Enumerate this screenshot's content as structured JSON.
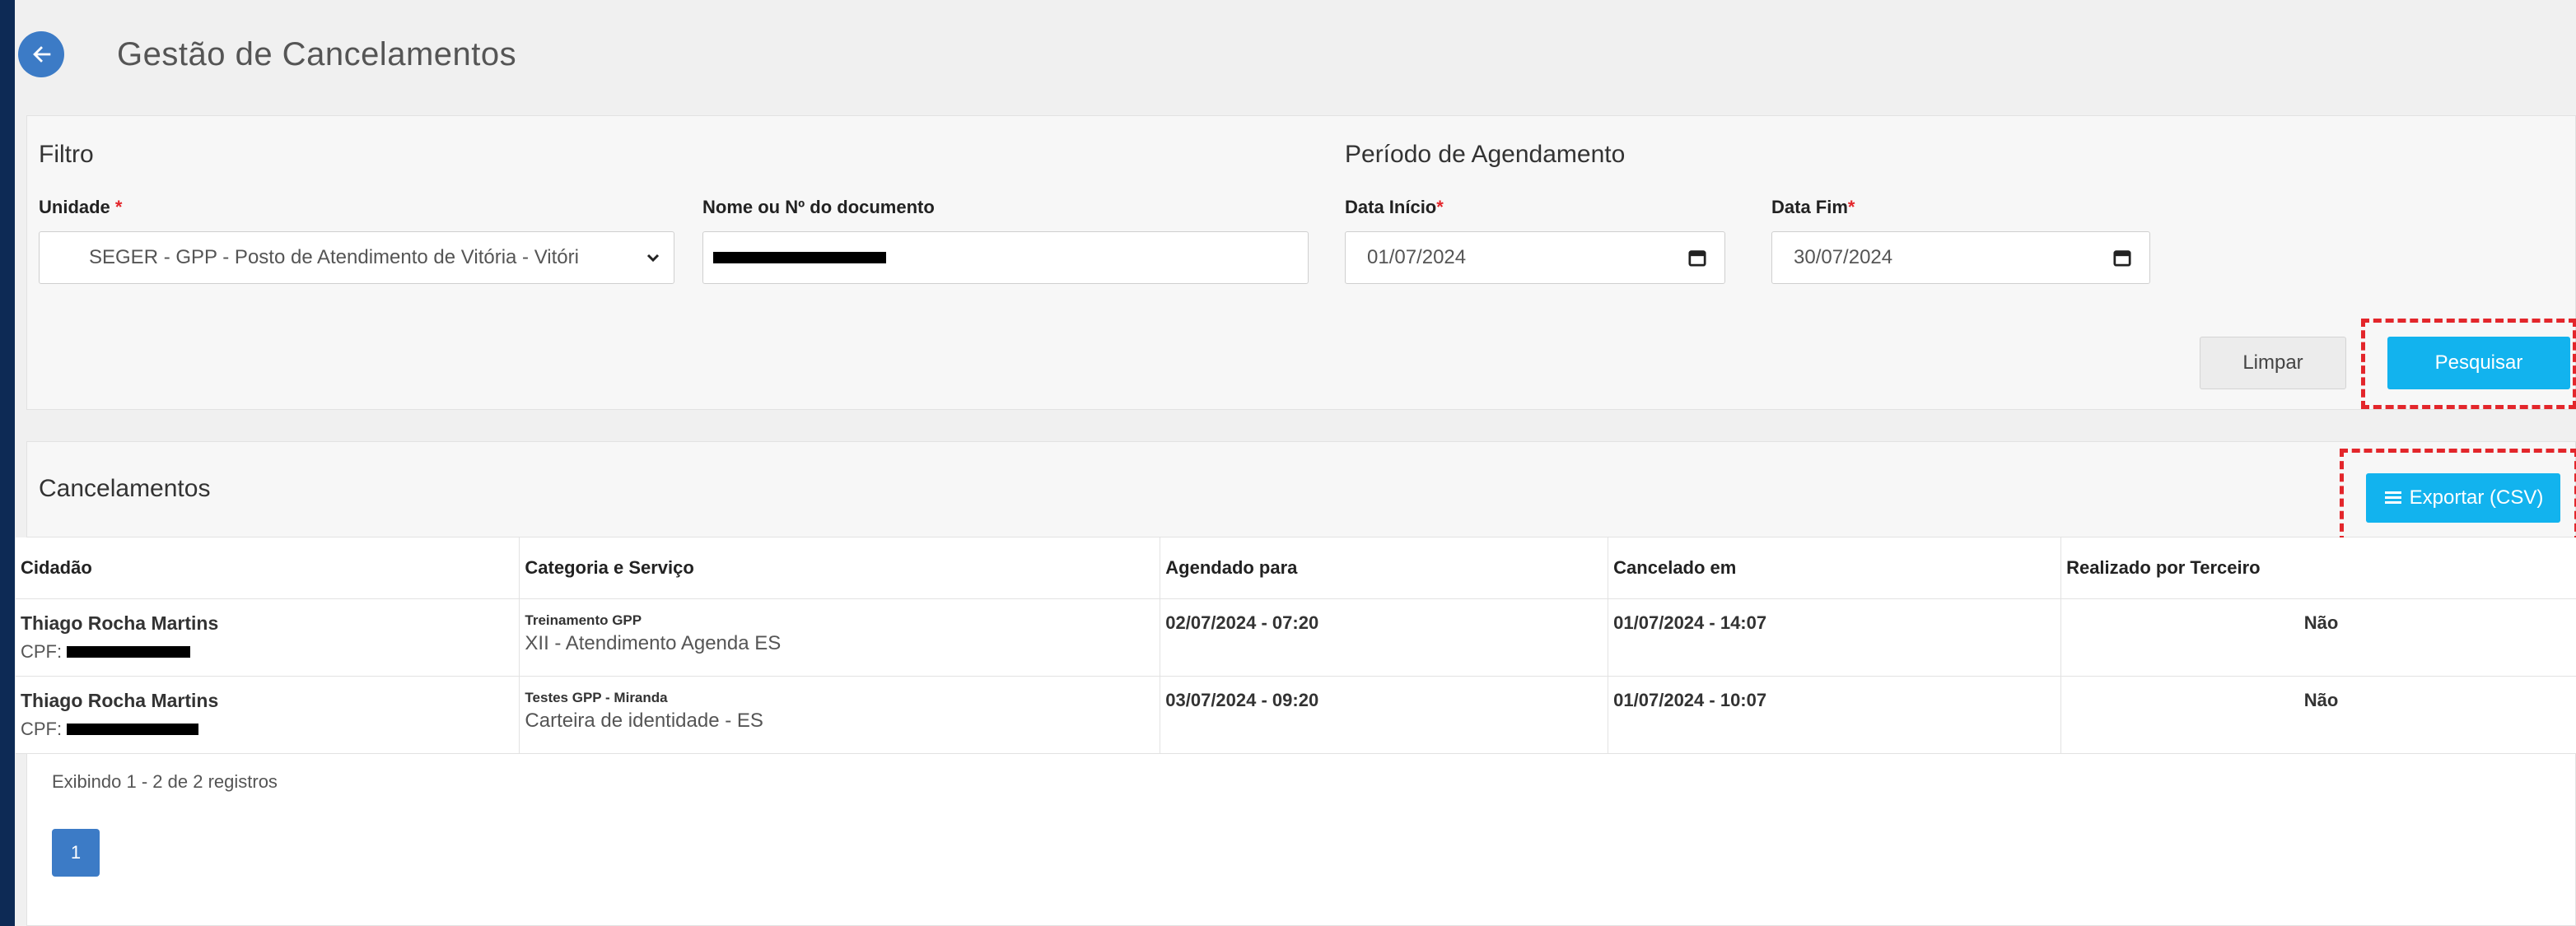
{
  "header": {
    "title": "Gestão de Cancelamentos"
  },
  "filter": {
    "title": "Filtro",
    "unidade_label": "Unidade",
    "required_mark": "*",
    "unidade_value": "SEGER - GPP - Posto de Atendimento de Vitória - Vitóri",
    "documento_label": "Nome ou Nº do documento",
    "periodo_title": "Período de Agendamento",
    "data_inicio_label": "Data Início",
    "data_inicio_value": "01/07/2024",
    "data_fim_label": "Data Fim",
    "data_fim_value": "30/07/2024",
    "limpar_label": "Limpar",
    "pesquisar_label": "Pesquisar"
  },
  "results": {
    "title": "Cancelamentos",
    "export_label": "Exportar (CSV)",
    "columns": [
      "Cidadão",
      "Categoria e Serviço",
      "Agendado para",
      "Cancelado em",
      "Realizado por Terceiro"
    ],
    "rows": [
      {
        "nome": "Thiago Rocha Martins",
        "cpf_label": "CPF:",
        "categoria": "Treinamento GPP",
        "servico": "XII - Atendimento Agenda ES",
        "agendado": "02/07/2024 - 07:20",
        "cancelado": "01/07/2024 - 14:07",
        "terceiro": "Não"
      },
      {
        "nome": "Thiago Rocha Martins",
        "cpf_label": "CPF:",
        "categoria": "Testes GPP - Miranda",
        "servico": "Carteira de identidade - ES",
        "agendado": "03/07/2024 - 09:20",
        "cancelado": "01/07/2024 - 10:07",
        "terceiro": "Não"
      }
    ],
    "showing": "Exibindo 1 - 2 de 2 registros",
    "page": "1"
  },
  "colors": {
    "frame": "#0d2a55",
    "primary": "#12b3ee",
    "accent_blue": "#3c7bc6",
    "required": "#e3262b"
  }
}
